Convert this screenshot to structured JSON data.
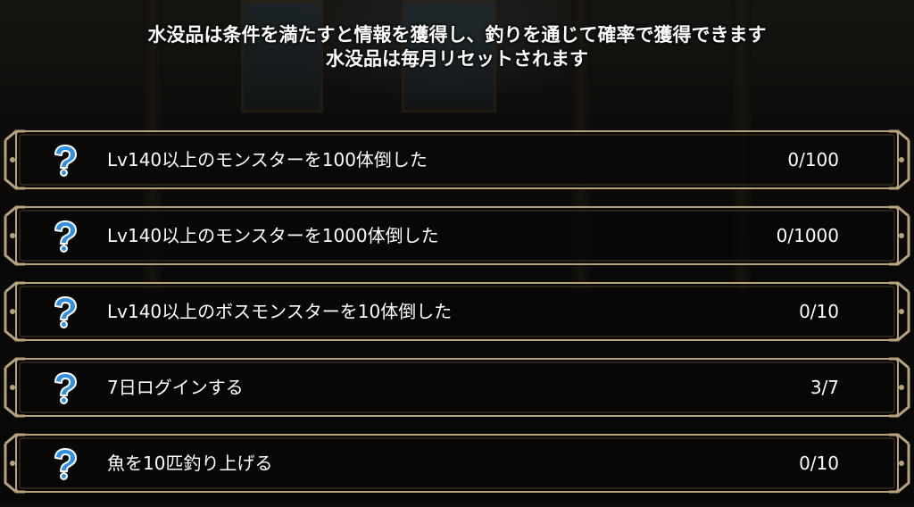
{
  "info_text": {
    "line1": "水没品は条件を満たすと情報を獲得し、釣りを通じて確率で獲得できます",
    "line2": "水没品は毎月リセットされます"
  },
  "conditions": [
    {
      "icon": "question-mark-icon",
      "label": "Lv140以上のモンスターを100体倒した",
      "progress": "0/100"
    },
    {
      "icon": "question-mark-icon",
      "label": "Lv140以上のモンスターを1000体倒した",
      "progress": "0/1000"
    },
    {
      "icon": "question-mark-icon",
      "label": "Lv140以上のボスモンスターを10体倒した",
      "progress": "0/10"
    },
    {
      "icon": "question-mark-icon",
      "label": "7日ログインする",
      "progress": "3/7"
    },
    {
      "icon": "question-mark-icon",
      "label": "魚を10匹釣り上げる",
      "progress": "0/10"
    }
  ],
  "colors": {
    "frame_gold": "#b8a27a",
    "frame_dark": "#4a3d28",
    "panel_bg": "#0a0908",
    "icon_blue": "#2f8fe0",
    "text": "#ffffff"
  }
}
